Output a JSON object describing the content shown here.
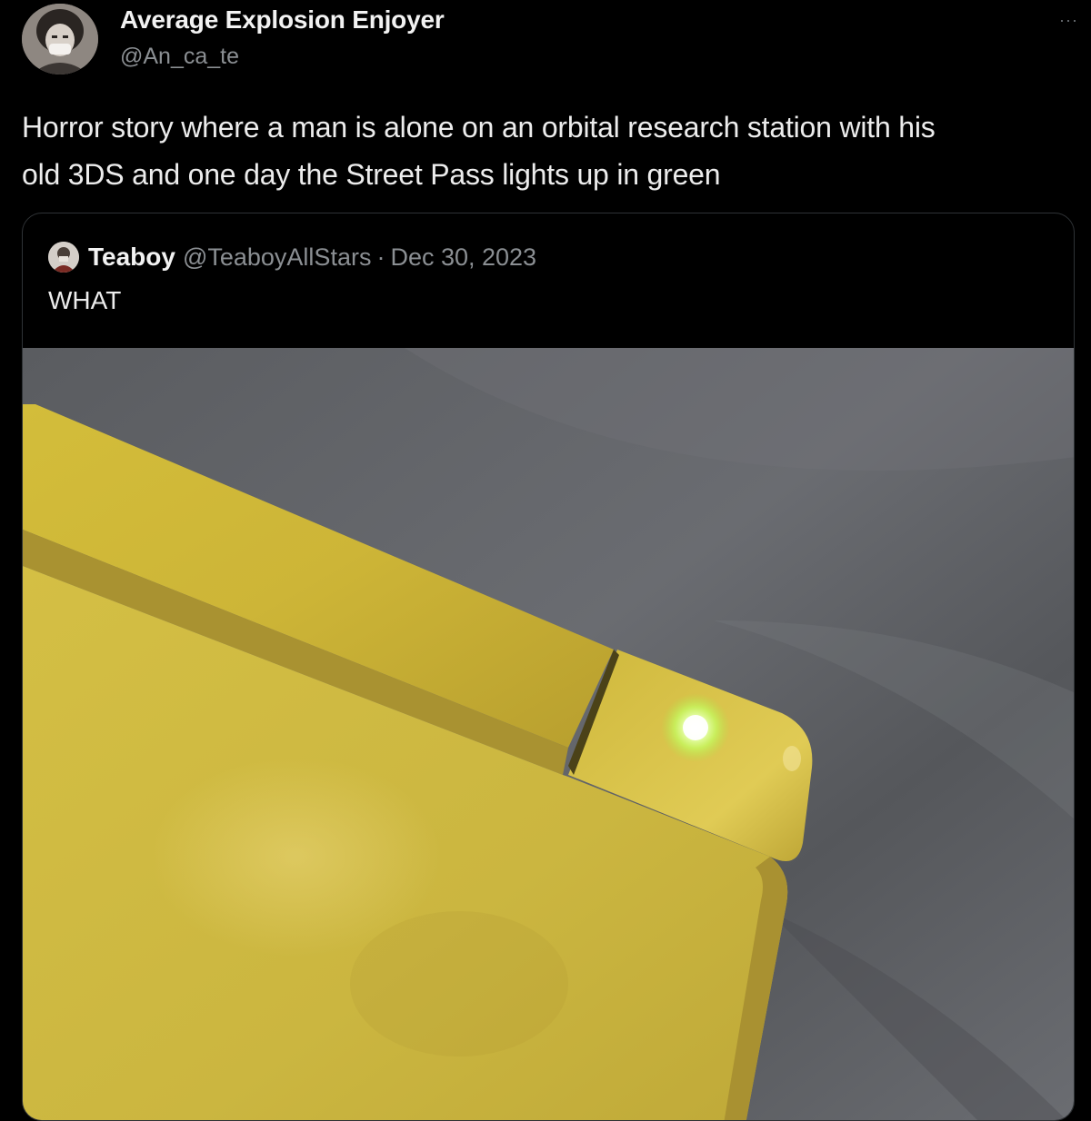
{
  "post": {
    "author_name": "Average Explosion Enjoyer",
    "author_handle": "@An_ca_te",
    "more_label": "···",
    "text": "Horror story where a man is alone on an orbital research station with his\nold 3DS and one day the Street Pass  lights up in green"
  },
  "quoted_post": {
    "author_name": "Teaboy",
    "author_handle": "@TeaboyAllStars",
    "separator": "·",
    "date": "Dec 30, 2023",
    "text": "WHAT"
  },
  "icons": {
    "more": "more-horizontal-icon",
    "avatar": "user-avatar",
    "quoted_avatar": "quoted-user-avatar"
  },
  "colors": {
    "background": "#000000",
    "primary_text": "#e7e9ea",
    "secondary_text": "#8b8f93",
    "border": "#2f3336",
    "device_yellow": "#d9c441",
    "fabric_gray": "#5d5f63",
    "led_green": "#d6ff7a"
  }
}
